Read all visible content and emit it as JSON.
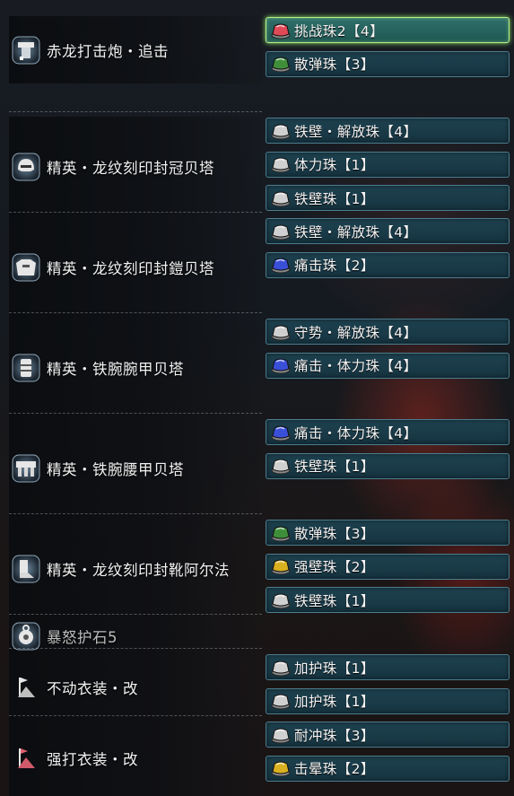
{
  "colors": {
    "slot_bg": "#1a3b48",
    "slot_border": "#4c7c8d",
    "selected_border": "#b8f08a",
    "gem_red": "#e04a56",
    "gem_green": "#3f8f3a",
    "gem_white": "#d0d0d0",
    "gem_blue": "#3a4fd8",
    "gem_yellow": "#d8b020"
  },
  "equipment": [
    {
      "name": "赤龙打击炮・追击",
      "icon": "bowgun-weapon-icon",
      "decorations": [
        {
          "label": "挑战珠2【4】",
          "gem": "red",
          "selected": true
        },
        {
          "label": "散弹珠【3】",
          "gem": "green",
          "selected": false
        }
      ]
    },
    {
      "name": "精英・龙纹刻印封冠贝塔",
      "icon": "helmet-icon",
      "decorations": [
        {
          "label": "铁壁・解放珠【4】",
          "gem": "white",
          "selected": false
        },
        {
          "label": "体力珠【1】",
          "gem": "white",
          "selected": false
        },
        {
          "label": "铁壁珠【1】",
          "gem": "white",
          "selected": false
        }
      ]
    },
    {
      "name": "精英・龙纹刻印封鎧贝塔",
      "icon": "chest-armor-icon",
      "decorations": [
        {
          "label": "铁壁・解放珠【4】",
          "gem": "white",
          "selected": false
        },
        {
          "label": "痛击珠【2】",
          "gem": "blue",
          "selected": false
        }
      ]
    },
    {
      "name": "精英・铁腕腕甲贝塔",
      "icon": "arm-armor-icon",
      "decorations": [
        {
          "label": "守势・解放珠【4】",
          "gem": "white",
          "selected": false
        },
        {
          "label": "痛击・体力珠【4】",
          "gem": "blue",
          "selected": false
        }
      ]
    },
    {
      "name": "精英・铁腕腰甲贝塔",
      "icon": "waist-armor-icon",
      "decorations": [
        {
          "label": "痛击・体力珠【4】",
          "gem": "blue",
          "selected": false
        },
        {
          "label": "铁壁珠【1】",
          "gem": "white",
          "selected": false
        }
      ]
    },
    {
      "name": "精英・龙纹刻印封靴阿尔法",
      "icon": "leg-armor-icon",
      "decorations": [
        {
          "label": "散弹珠【3】",
          "gem": "green",
          "selected": false
        },
        {
          "label": "强壁珠【2】",
          "gem": "yellow",
          "selected": false
        },
        {
          "label": "铁壁珠【1】",
          "gem": "white",
          "selected": false
        }
      ]
    },
    {
      "name": "暴怒护石5",
      "icon": "charm-icon",
      "decorations": []
    },
    {
      "name": "不动衣装・改",
      "icon": "mantle-icon",
      "decorations": [
        {
          "label": "加护珠【1】",
          "gem": "white",
          "selected": false
        },
        {
          "label": "加护珠【1】",
          "gem": "white",
          "selected": false
        }
      ]
    },
    {
      "name": "强打衣装・改",
      "icon": "mantle-red-icon",
      "decorations": [
        {
          "label": "耐冲珠【3】",
          "gem": "white",
          "selected": false
        },
        {
          "label": "击晕珠【2】",
          "gem": "yellow",
          "selected": false
        }
      ]
    }
  ]
}
